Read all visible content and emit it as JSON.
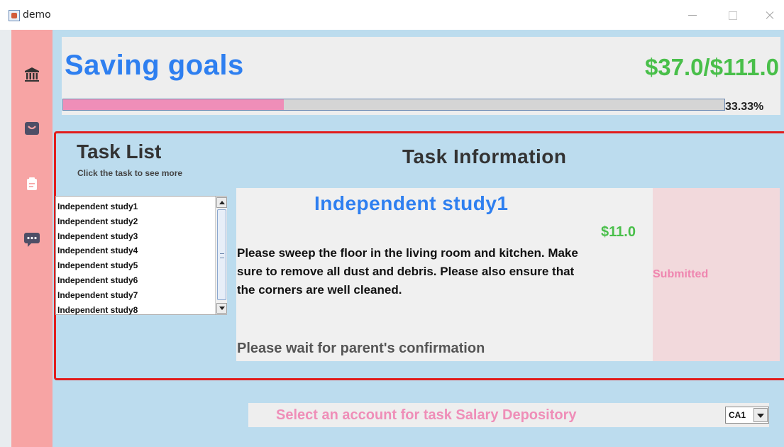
{
  "window": {
    "title": "demo",
    "icon": "java-app-icon",
    "controls": [
      "minimize-icon",
      "maximize-icon",
      "close-icon"
    ]
  },
  "sidebar": {
    "background": "#f7a4a4",
    "items": [
      {
        "name": "bank-icon"
      },
      {
        "name": "shopping-bag-icon"
      },
      {
        "name": "clipboard-icon"
      },
      {
        "name": "chat-icon"
      }
    ]
  },
  "goal": {
    "title": "Saving goals",
    "amount": "$37.0/$111.0",
    "progress_percent": "33.33%",
    "progress_value": 0.3333
  },
  "task_list": {
    "title": "Task List",
    "subtitle": "Click the task to see more",
    "items": [
      "Independent study1",
      "Independent study2",
      "Independent study3",
      "Independent study4",
      "Independent study5",
      "Independent study6",
      "Independent study7",
      "Independent study8"
    ]
  },
  "task_info": {
    "title": "Task Information",
    "task_name": "Independent study1",
    "reward": "$11.0",
    "description": "Please sweep the floor in the living room and kitchen. Make sure to remove all dust and debris. Please also ensure that the corners are well cleaned.",
    "wait_message": "Please wait for parent's confirmation",
    "status": "Submitted"
  },
  "deposit": {
    "label": "Select an account for task Salary Depository",
    "selected_account": "CA1"
  },
  "colors": {
    "content_bg": "#bcdcee",
    "accent_blue": "#2e7ff0",
    "accent_green": "#49bf4a",
    "accent_pink": "#ef8eb8",
    "panel_border": "#e11c1c"
  }
}
